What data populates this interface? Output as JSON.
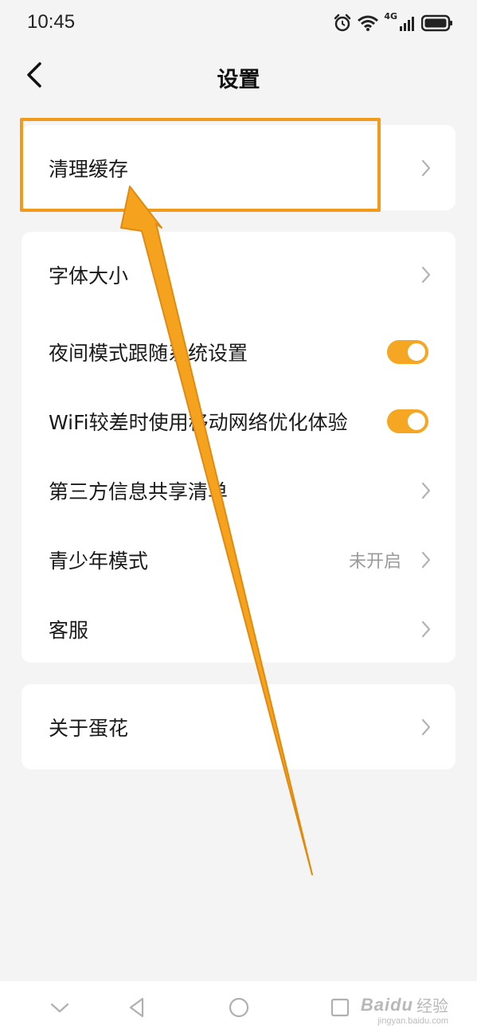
{
  "status_bar": {
    "time": "10:45",
    "network": "4G"
  },
  "header": {
    "title": "设置"
  },
  "sections": {
    "cache": {
      "label": "清理缓存"
    },
    "font_size": {
      "label": "字体大小"
    },
    "night_mode": {
      "label": "夜间模式跟随系统设置",
      "enabled": true
    },
    "wifi_opt": {
      "label": "WiFi较差时使用移动网络优化体验",
      "enabled": true
    },
    "third_party": {
      "label": "第三方信息共享清单"
    },
    "youth_mode": {
      "label": "青少年模式",
      "value": "未开启"
    },
    "customer_service": {
      "label": "客服"
    },
    "about": {
      "label": "关于蛋花"
    }
  },
  "watermark": {
    "brand": "Baidu",
    "text": "经验",
    "url": "jingyan.baidu.com"
  },
  "colors": {
    "accent": "#f5a623",
    "annotation": "#f29a1c",
    "background": "#f4f4f4",
    "card": "#ffffff"
  }
}
